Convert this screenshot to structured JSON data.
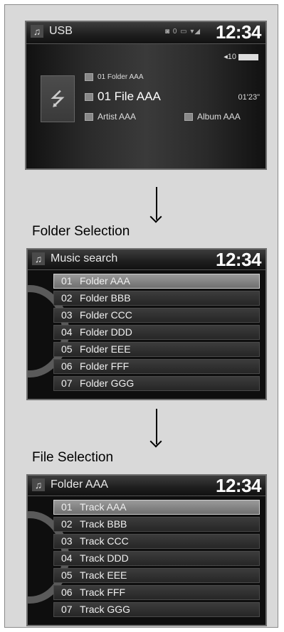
{
  "usb_screen": {
    "source_label": "USB",
    "status_icons": "◙ 0 ▭ ▾◢",
    "clock": "12:34",
    "volume_level": "10",
    "folder": "01  Folder AAA",
    "file": "01 File AAA",
    "elapsed": "01'23\"",
    "artist": "Artist AAA",
    "album": "Album AAA"
  },
  "labels": {
    "folder_selection": "Folder Selection",
    "file_selection": "File Selection"
  },
  "music_search": {
    "title": "Music search",
    "clock": "12:34",
    "rows": [
      {
        "num": "01",
        "name": "Folder AAA"
      },
      {
        "num": "02",
        "name": "Folder BBB"
      },
      {
        "num": "03",
        "name": "Folder CCC"
      },
      {
        "num": "04",
        "name": "Folder DDD"
      },
      {
        "num": "05",
        "name": "Folder EEE"
      },
      {
        "num": "06",
        "name": "Folder FFF"
      },
      {
        "num": "07",
        "name": "Folder GGG"
      }
    ]
  },
  "folder_view": {
    "title": "Folder AAA",
    "clock": "12:34",
    "rows": [
      {
        "num": "01",
        "name": "Track AAA"
      },
      {
        "num": "02",
        "name": "Track BBB"
      },
      {
        "num": "03",
        "name": "Track CCC"
      },
      {
        "num": "04",
        "name": "Track DDD"
      },
      {
        "num": "05",
        "name": "Track EEE"
      },
      {
        "num": "06",
        "name": "Track FFF"
      },
      {
        "num": "07",
        "name": "Track GGG"
      }
    ]
  },
  "icons": {
    "music_note": "♫",
    "usb": "⭍"
  }
}
